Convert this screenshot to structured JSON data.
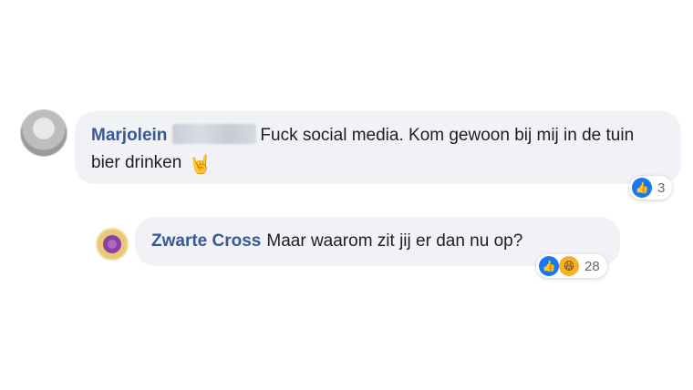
{
  "comments": [
    {
      "author": "Marjolein",
      "text": "Fuck social media. Kom gewoon bij mij in de tuin bier drinken",
      "emoji": "rock-hand-emoji",
      "reaction_count": "3"
    },
    {
      "author": "Zwarte Cross",
      "text": "Maar waarom zit jij er dan nu op?",
      "reaction_count": "28"
    }
  ],
  "colors": {
    "bubble": "#f0f2f5",
    "author": "#385898",
    "like": "#1877f2",
    "haha": "#f7b125"
  }
}
